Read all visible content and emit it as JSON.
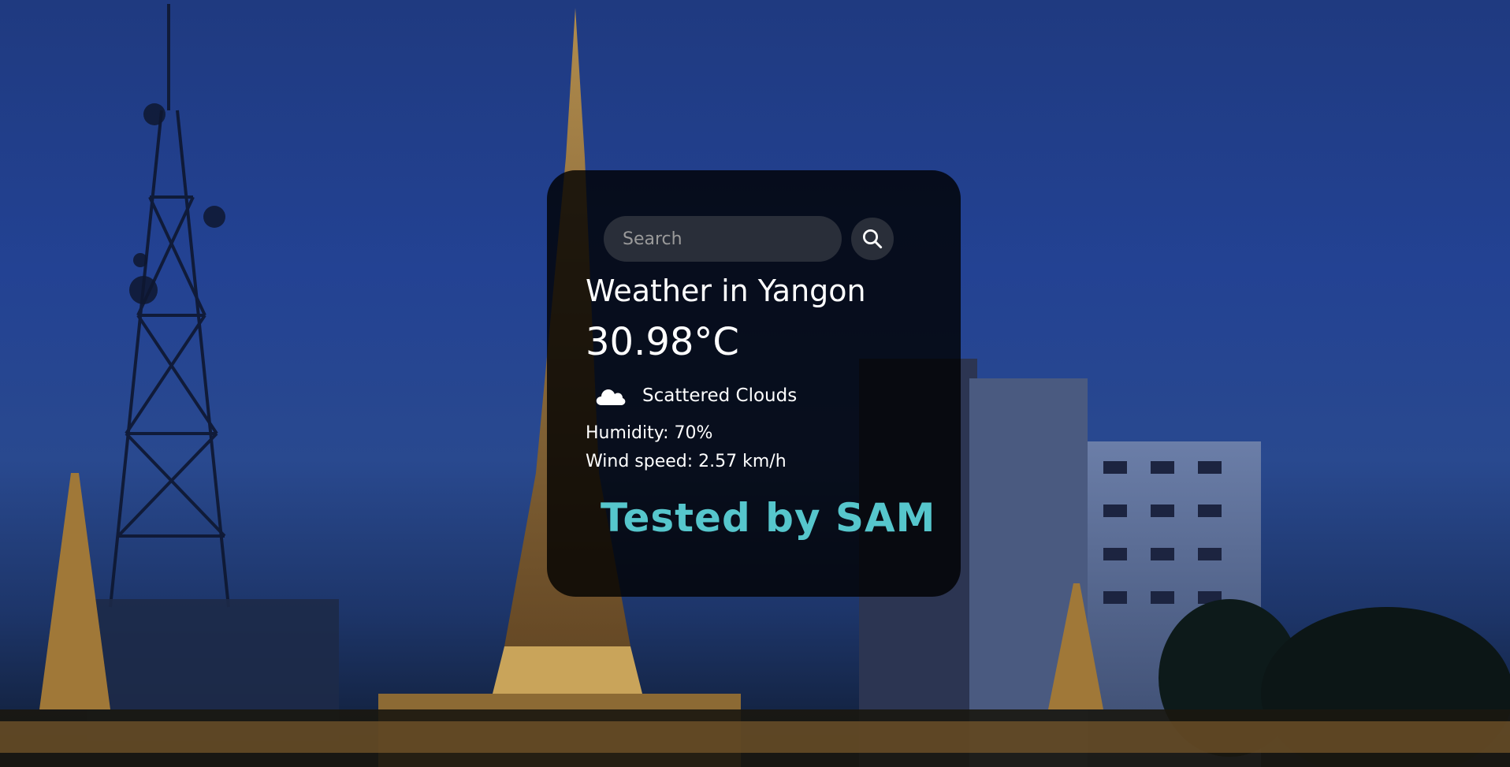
{
  "search": {
    "placeholder": "Search",
    "icon": "search-icon"
  },
  "weather": {
    "city_title": "Weather in Yangon",
    "temperature": "30.98°C",
    "icon": "cloud-icon",
    "description": "Scattered Clouds",
    "humidity": "Humidity: 70%",
    "wind_speed": "Wind speed: 2.57 km/h"
  },
  "footer": {
    "tested_by": "Tested by SAM"
  },
  "colors": {
    "card_background": "#000000",
    "tested_text": "#56c6cc",
    "sky": "#234293"
  }
}
